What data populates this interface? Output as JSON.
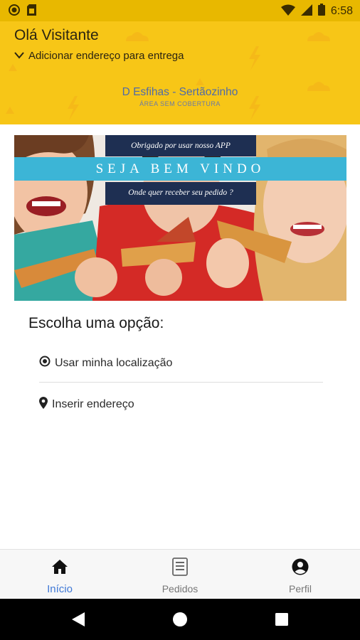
{
  "status_bar": {
    "time": "6:58",
    "icons": [
      "notification-icon",
      "sim-icon",
      "wifi-icon",
      "signal-icon",
      "battery-icon"
    ]
  },
  "header": {
    "greeting": "Olá Visitante",
    "address_prompt": "Adicionar endereço para entrega",
    "store_name": "D Esfihas - Sertãozinho",
    "coverage_status": "ÁREA SEM COBERTURA",
    "background_color": "#f7c617"
  },
  "banner": {
    "line1": "Obrigado por usar nosso APP",
    "line2": "SEJA BEM VINDO",
    "line3": "Onde quer receber seu pedido ?"
  },
  "options": {
    "title": "Escolha uma opção:",
    "use_location": "Usar minha localização",
    "insert_address": "Inserir endereço"
  },
  "bottom_nav": {
    "items": [
      {
        "label": "Início",
        "icon": "home-icon",
        "active": true
      },
      {
        "label": "Pedidos",
        "icon": "orders-icon",
        "active": false
      },
      {
        "label": "Perfil",
        "icon": "profile-icon",
        "active": false
      }
    ],
    "active_color": "#3f78d6"
  },
  "system_nav": {
    "buttons": [
      "back-icon",
      "home-circle-icon",
      "recents-icon"
    ]
  }
}
